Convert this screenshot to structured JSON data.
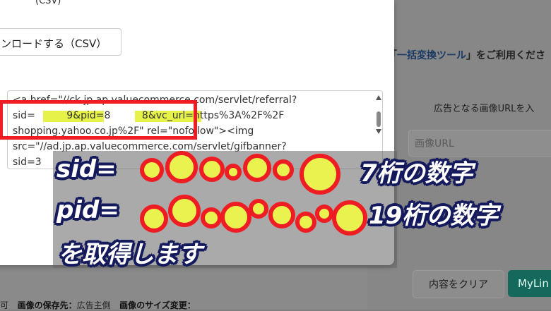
{
  "background": {
    "tool_text_prefix": "「",
    "tool_text_link": "一括変換ツール",
    "tool_text_suffix": "」をご利用くださ",
    "image_url_label": "広告となる画像URLを入",
    "image_url_placeholder": "画像URL",
    "clear_button": "内容をクリア",
    "mylink_button": "MyLin",
    "bottom_left": "可",
    "save_dest_label": "画像の保存先：",
    "save_dest_value": "広告主側",
    "resize_label": "画像のサイズ変更："
  },
  "modal": {
    "top_fragment": "(CSV)",
    "csv_button": "ンロードする（CSV）",
    "code_lines": [
      "<a href=\"//ck.jp.ap.valuecommerce.com/servlet/referral?",
      "sid=          9&pid=8          8&vc_url=https%3A%2F%2F",
      "shopping.yahoo.co.jp%2F\" rel=\"nofollow\"><img",
      "src=\"//ad.jp.ap.valuecommerce.com/servlet/gifbanner?",
      "sid=3"
    ]
  },
  "overlay": {
    "line1_prefix": "sid=",
    "line1_suffix": "7桁の数字",
    "line2_prefix": "pid=",
    "line2_suffix": "19桁の数字",
    "line3": "を取得します"
  },
  "colors": {
    "highlight_red": "#ee1d23",
    "highlight_yellow": "#e6f24a",
    "outline_navy": "#141a5c",
    "mylink_green": "#15685c"
  }
}
